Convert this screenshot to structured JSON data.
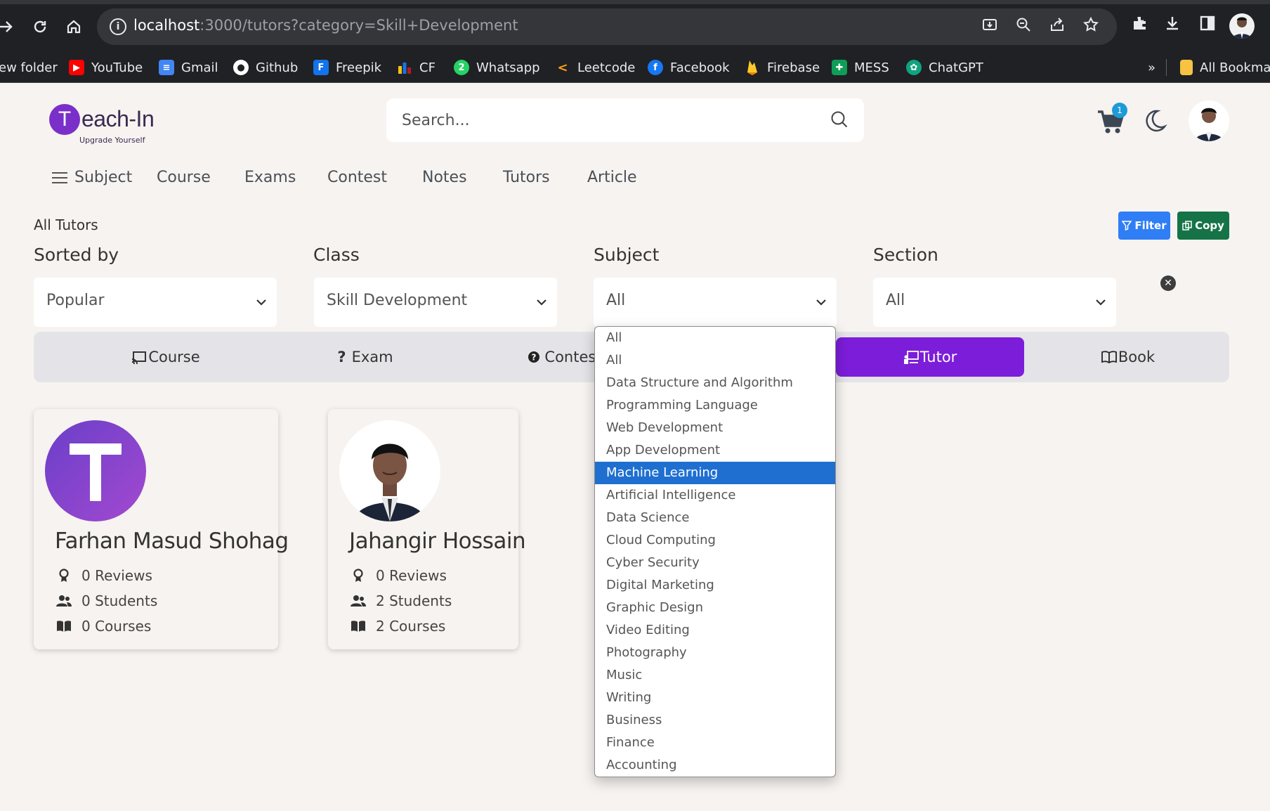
{
  "browser": {
    "url_host": "localhost",
    "url_path": ":3000/tutors?category=Skill+Development",
    "bookmarks": [
      {
        "label": "ew folder",
        "icon": "folder-icon",
        "color": "#f6c343"
      },
      {
        "label": "YouTube",
        "icon": "youtube-icon",
        "color": "#ff0000"
      },
      {
        "label": "Gmail",
        "icon": "docs-icon",
        "color": "#4285f4"
      },
      {
        "label": "Github",
        "icon": "github-icon",
        "color": "#ffffff"
      },
      {
        "label": "Freepik",
        "icon": "freepik-icon",
        "color": "#1273eb"
      },
      {
        "label": "CF",
        "icon": "codeforces-icon",
        "color": "#f4c20d"
      },
      {
        "label": "Whatsapp",
        "icon": "whatsapp-icon",
        "color": "#25d366"
      },
      {
        "label": "Leetcode",
        "icon": "leetcode-icon",
        "color": "#ffa116"
      },
      {
        "label": "Facebook",
        "icon": "facebook-icon",
        "color": "#1877f2"
      },
      {
        "label": "Firebase",
        "icon": "firebase-icon",
        "color": "#ffca28"
      },
      {
        "label": "MESS",
        "icon": "sheets-icon",
        "color": "#0f9d58"
      },
      {
        "label": "ChatGPT",
        "icon": "chatgpt-icon",
        "color": "#10a37f"
      }
    ],
    "more_chevron": "»",
    "all_bookmarks": "All Bookmar"
  },
  "site": {
    "logo_letter": "T",
    "logo_text": "each-In",
    "tagline": "Upgrade Yourself",
    "search_placeholder": "Search...",
    "cart_count": "1",
    "menu": [
      "Subject",
      "Course",
      "Exams",
      "Contest",
      "Notes",
      "Tutors",
      "Article"
    ]
  },
  "page": {
    "heading": "All Tutors",
    "filter_button": "Filter",
    "copy_button": "Copy",
    "filters": [
      {
        "label": "Sorted by",
        "value": "Popular"
      },
      {
        "label": "Class",
        "value": "Skill Development"
      },
      {
        "label": "Subject",
        "value": "All"
      },
      {
        "label": "Section",
        "value": "All"
      }
    ],
    "tabs": [
      {
        "label": "Course",
        "icon": "cast-icon",
        "active": false
      },
      {
        "label": "Exam",
        "icon": "question-icon",
        "active": false
      },
      {
        "label": "Contest",
        "icon": "help-circle-icon",
        "active": false
      },
      {
        "label": "Tutor",
        "icon": "chalkboard-icon",
        "active": true
      },
      {
        "label": "Book",
        "icon": "book-icon",
        "active": false
      }
    ]
  },
  "tutors": [
    {
      "name": "Farhan Masud Shohag",
      "reviews": "0 Reviews",
      "students": "0 Students",
      "courses": "0 Courses",
      "avatar": "letter-T"
    },
    {
      "name": "Jahangir Hossain",
      "reviews": "0 Reviews",
      "students": "2 Students",
      "courses": "2 Courses",
      "avatar": "photo"
    }
  ],
  "subject_dropdown": {
    "selected": "Machine Learning",
    "options": [
      "All",
      "All",
      "Data Structure and Algorithm",
      "Programming Language",
      "Web Development",
      "App Development",
      "Machine Learning",
      "Artificial Intelligence",
      "Data Science",
      "Cloud Computing",
      "Cyber Security",
      "Digital Marketing",
      "Graphic Design",
      "Video Editing",
      "Photography",
      "Music",
      "Writing",
      "Business",
      "Finance",
      "Accounting"
    ]
  }
}
